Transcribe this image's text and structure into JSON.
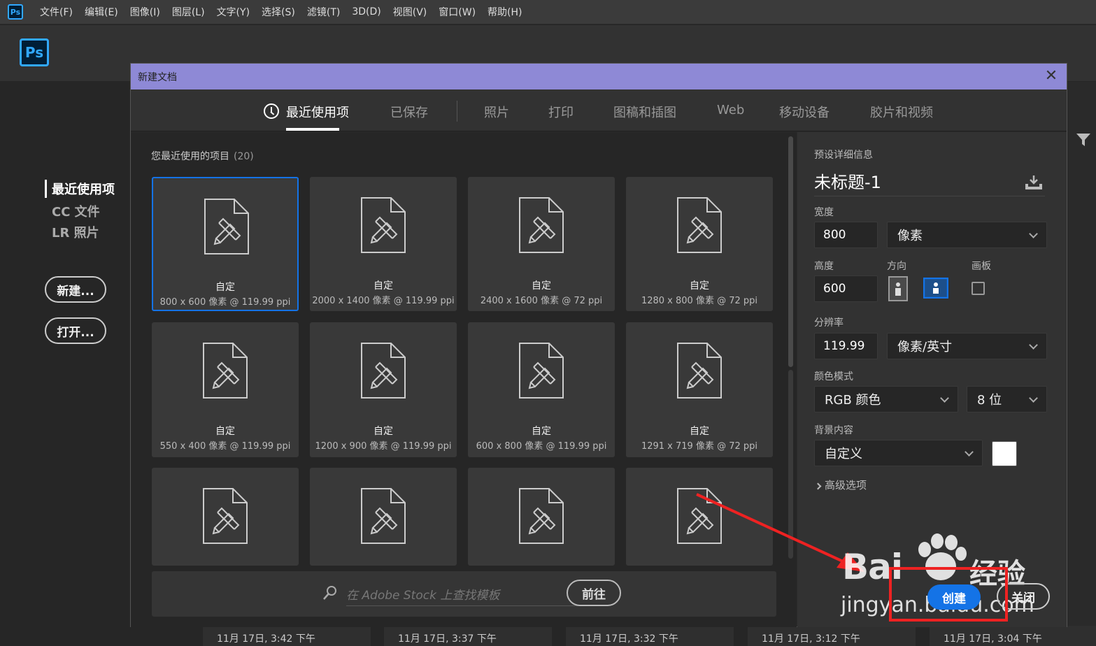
{
  "menubar": {
    "app_icon": "Ps",
    "items": [
      "文件(F)",
      "编辑(E)",
      "图像(I)",
      "图层(L)",
      "文字(Y)",
      "选择(S)",
      "滤镜(T)",
      "3D(D)",
      "视图(V)",
      "窗口(W)",
      "帮助(H)"
    ]
  },
  "home": {
    "logo": "Ps",
    "nav": [
      "最近使用项",
      "CC 文件",
      "LR 照片"
    ],
    "new_button": "新建...",
    "open_button": "打开...",
    "recent_files": [
      "11月 17日, 3:42 下午",
      "11月 17日, 3:37 下午",
      "11月 17日, 3:32 下午",
      "11月 17日, 3:12 下午",
      "11月 17日, 3:04 下午"
    ]
  },
  "dialog": {
    "title": "新建文档",
    "close_glyph": "✕",
    "tabs": [
      "最近使用项",
      "已保存",
      "照片",
      "打印",
      "图稿和插图",
      "Web",
      "移动设备",
      "胶片和视频"
    ],
    "active_tab": "最近使用项",
    "recent_title": "您最近使用的项目",
    "recent_count": "(20)",
    "tiles": [
      {
        "name": "自定",
        "desc": "800 x 600 像素 @ 119.99 ppi"
      },
      {
        "name": "自定",
        "desc": "2000 x 1400 像素 @ 119.99 ppi"
      },
      {
        "name": "自定",
        "desc": "2400 x 1600 像素 @ 72 ppi"
      },
      {
        "name": "自定",
        "desc": "1280 x 800 像素 @ 72 ppi"
      },
      {
        "name": "自定",
        "desc": "550 x 400 像素 @ 119.99 ppi"
      },
      {
        "name": "自定",
        "desc": "1200 x 900 像素 @ 119.99 ppi"
      },
      {
        "name": "自定",
        "desc": "600 x 800 像素 @ 119.99 ppi"
      },
      {
        "name": "自定",
        "desc": "1291 x 719 像素 @ 72 ppi"
      }
    ],
    "stock_placeholder": "在 Adobe Stock 上查找模板",
    "stock_go": "前往",
    "preset": {
      "section_title": "预设详细信息",
      "doc_name": "未标题-1",
      "width_label": "宽度",
      "width_value": "800",
      "width_unit": "像素",
      "height_label": "高度",
      "height_value": "600",
      "orientation_label": "方向",
      "artboard_label": "画板",
      "resolution_label": "分辨率",
      "resolution_value": "119.99",
      "resolution_unit": "像素/英寸",
      "color_mode_label": "颜色模式",
      "color_mode": "RGB 颜色",
      "bit_depth": "8 位",
      "background_label": "背景内容",
      "background": "自定义",
      "background_swatch": "#ffffff",
      "advanced": "高级选项",
      "create_button": "创建",
      "close_button": "关闭"
    }
  },
  "watermark": {
    "brand": "Bai",
    "cn": "经验",
    "url": "jingyan.baidu.com"
  },
  "colors": {
    "accent": "#1473e6",
    "dialog_title_bg": "#8e89d6",
    "annotation": "#ee2222"
  }
}
